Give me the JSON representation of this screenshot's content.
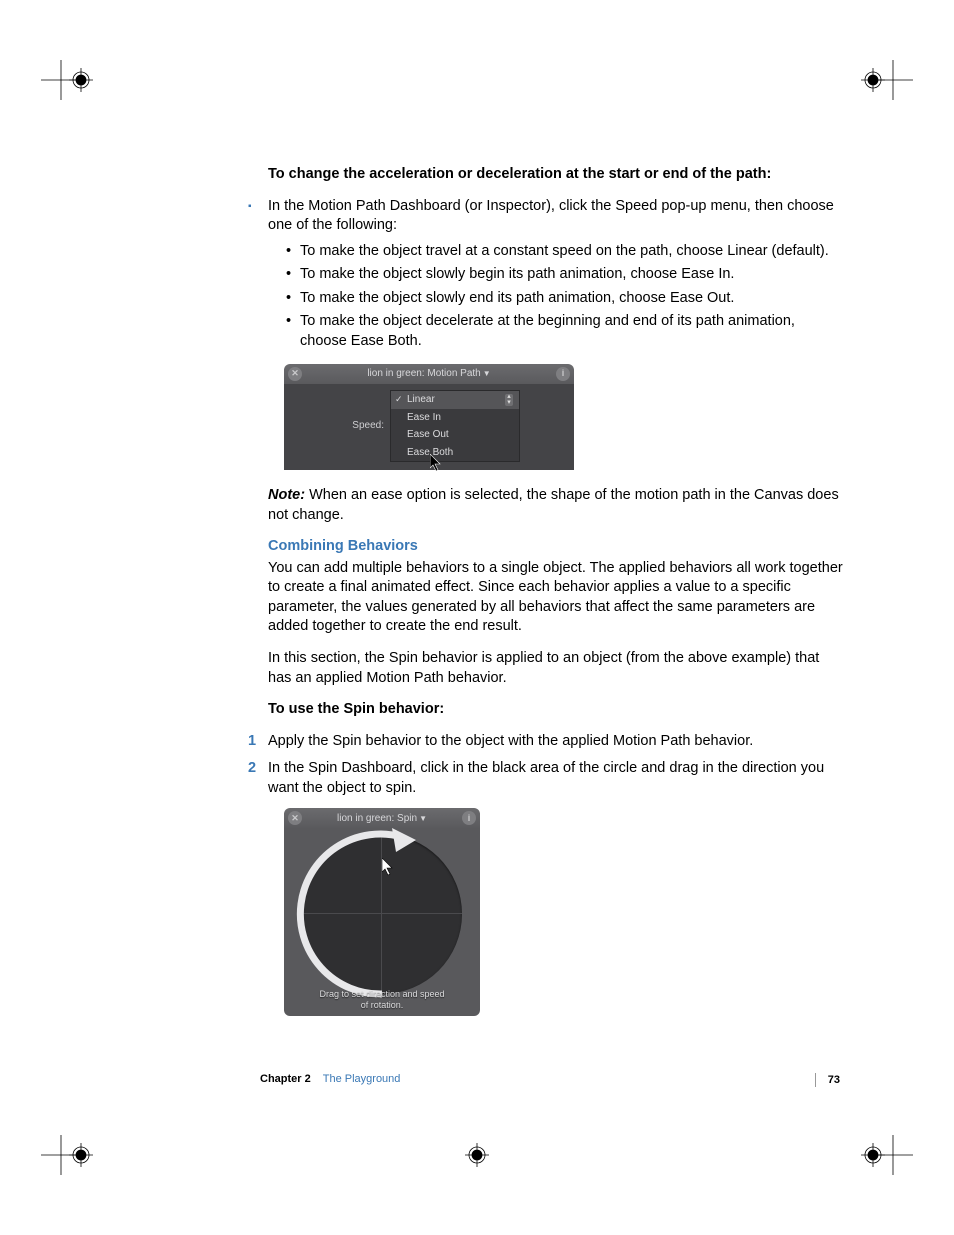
{
  "headings": {
    "h1": "To change the acceleration or deceleration at the start or end of the path:",
    "h2": "Combining Behaviors",
    "h3": "To use the Spin behavior:"
  },
  "mainBullet": "In the Motion Path Dashboard (or Inspector), click the Speed pop-up menu, then choose one of the following:",
  "sub": {
    "a": "To make the object travel at a constant speed on the path, choose Linear (default).",
    "b": "To make the object slowly begin its path animation, choose Ease In.",
    "c": "To make the object slowly end its path animation, choose Ease Out.",
    "d": "To make the object decelerate at the beginning and end of its path animation, choose Ease Both."
  },
  "noteLabel": "Note:",
  "noteText": "  When an ease option is selected, the shape of the motion path in the Canvas does not change.",
  "para1": "You can add multiple behaviors to a single object. The applied behaviors all work together to create a final animated effect. Since each behavior applies a value to a specific parameter, the values generated by all behaviors that affect the same parameters are added together to create the end result.",
  "para2": "In this section, the Spin behavior is applied to an object (from the above example) that has an applied Motion Path behavior.",
  "step1": "Apply the Spin behavior to the object with the applied Motion Path behavior.",
  "step2": "In the Spin Dashboard, click in the black area of the circle and drag in the direction you want the object to spin.",
  "fig1": {
    "title": "lion in green: Motion Path",
    "speedLabel": "Speed:",
    "options": {
      "o1": "Linear",
      "o2": "Ease In",
      "o3": "Ease Out",
      "o4": "Ease Both"
    }
  },
  "fig2": {
    "title": "lion in green: Spin",
    "hint1": "Drag to set direction and speed",
    "hint2": "of rotation."
  },
  "footer": {
    "chapter": "Chapter 2",
    "title": "The Playground",
    "page": "73"
  }
}
